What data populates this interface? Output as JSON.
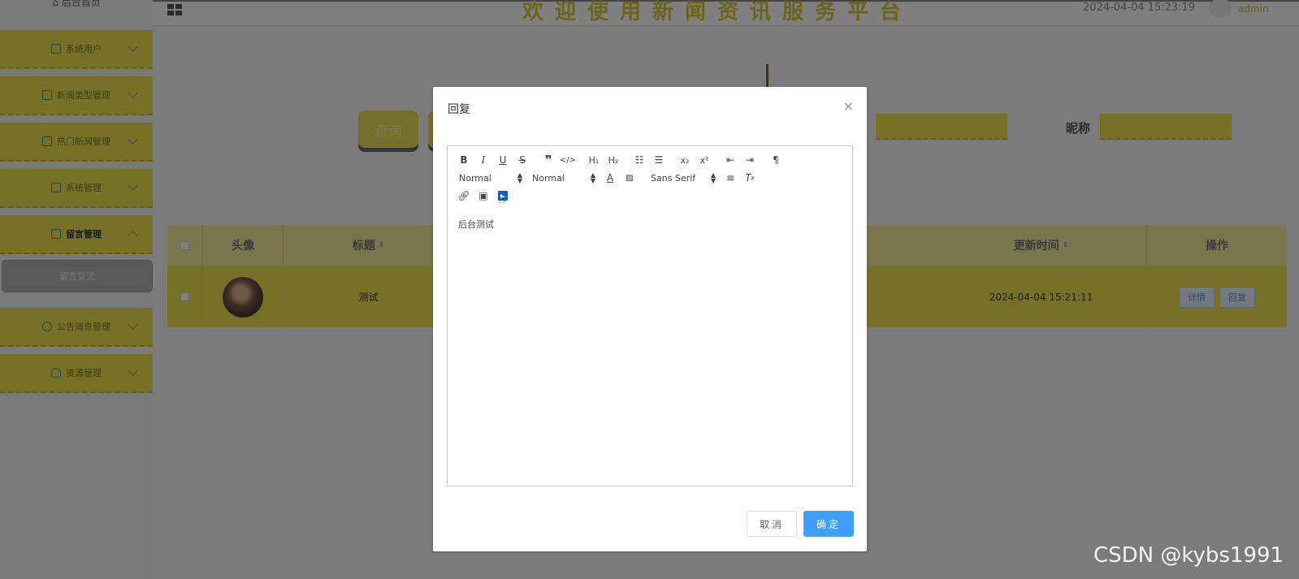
{
  "header": {
    "site_title": "欢迎使用新闻资讯服务平台",
    "datetime": "2024-04-04 15:23:19",
    "user_name": "admin"
  },
  "sidebar": {
    "home_label": "后台首页",
    "items": [
      {
        "label": "系统用户",
        "icon": "user-icon",
        "expanded": false
      },
      {
        "label": "新闻类型管理",
        "icon": "edit-icon",
        "expanded": false
      },
      {
        "label": "热门新闻管理",
        "icon": "edit-icon",
        "expanded": false
      },
      {
        "label": "系统管理",
        "icon": "chart-icon",
        "expanded": false
      },
      {
        "label": "留言管理",
        "icon": "check-square-icon",
        "expanded": true
      },
      {
        "label": "公告消息管理",
        "icon": "info-icon",
        "expanded": false
      },
      {
        "label": "资源管理",
        "icon": "bulb-icon",
        "expanded": false
      }
    ],
    "sub_item_label": "留言交流"
  },
  "search": {
    "query_label": "查询",
    "nickname_label": "昵称"
  },
  "table": {
    "headers": [
      "头像",
      "标题",
      "更新时间",
      "操作"
    ],
    "row": {
      "title": "测试",
      "updated": "2024-04-04 15:21:11",
      "detail_label": "详情",
      "reply_label": "回复"
    }
  },
  "dialog": {
    "title": "回复",
    "close_symbol": "×",
    "toolbar": {
      "header_select": "Normal",
      "size_select": "Normal",
      "font_select": "Sans Serif"
    },
    "content": "后台测试",
    "cancel_label": "取消",
    "confirm_label": "确定"
  },
  "watermark": "CSDN @kybs1991"
}
